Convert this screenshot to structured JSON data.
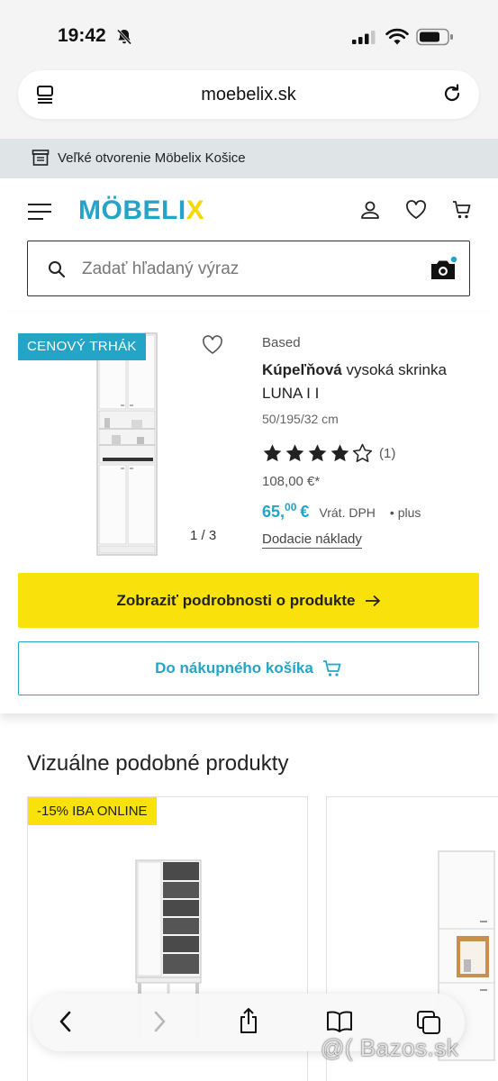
{
  "status_bar": {
    "time": "19:42"
  },
  "browser": {
    "url": "moebelix.sk"
  },
  "promo": {
    "text": "Veľké otvorenie Möbelix Košice"
  },
  "header": {
    "logo_main": "MÖBELI",
    "logo_x": "X",
    "search_placeholder": "Zadať hľadaný výraz"
  },
  "product": {
    "badge": "CENOVÝ TRHÁK",
    "brand": "Based",
    "title_bold": "Kúpeľňová",
    "title_rest": " vysoká skrinka LUNA I I",
    "dimensions": "50/195/32 cm",
    "rating_value": 4,
    "rating_max": 5,
    "rating_count": "(1)",
    "old_price": "108,00 €*",
    "price_whole": "65,",
    "price_cents": "00",
    "currency": "€",
    "vat_label": "Vrát. DPH",
    "plus_label": "• plus",
    "shipping_label": "Dodacie náklady",
    "image_counter": "1 / 3",
    "details_button": "Zobraziť podrobnosti o produkte",
    "cart_button": "Do nákupného košíka"
  },
  "similar": {
    "title": "Vizuálne podobné produkty",
    "items": [
      {
        "badge": "-15% IBA ONLINE"
      },
      {
        "badge": ""
      }
    ]
  },
  "watermark": "@( Bazos.sk",
  "colors": {
    "brand_blue": "#24a5c8",
    "brand_yellow": "#f9e20b",
    "banner_gray": "#dfe4e7"
  }
}
